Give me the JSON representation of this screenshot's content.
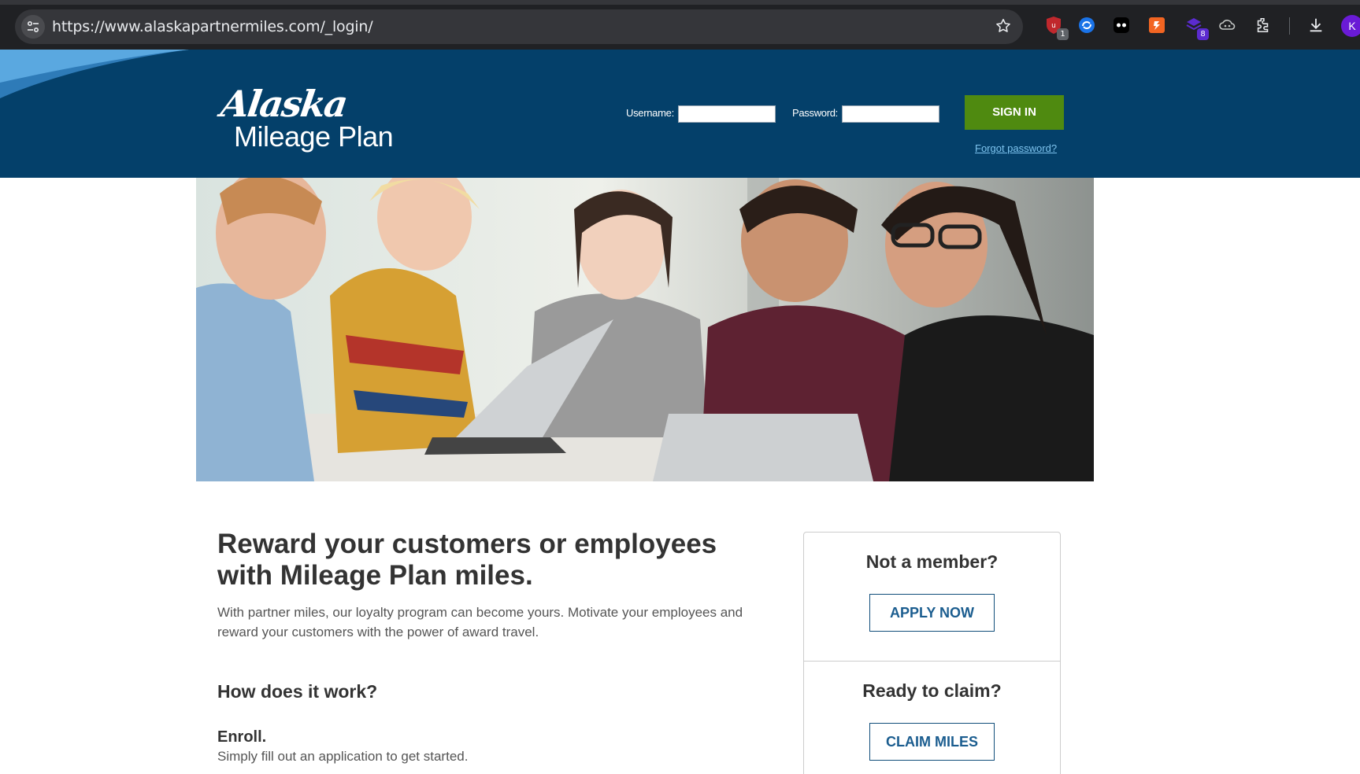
{
  "browser": {
    "url": "https://www.alaskapartnermiles.com/_login/",
    "extensions": [
      {
        "name": "ublock",
        "badge": "1",
        "color": "#c0282d"
      },
      {
        "name": "sync",
        "badge": "",
        "color": "#1a73e8"
      },
      {
        "name": "dark-ext",
        "badge": "",
        "color": "#000000"
      },
      {
        "name": "orange-ext",
        "badge": "",
        "color": "#f26522"
      },
      {
        "name": "purple-ext",
        "badge": "8",
        "color": "#5b2bd0"
      }
    ],
    "profile_initial": "K"
  },
  "header": {
    "logo_brand": "Alaska",
    "logo_product": "Mileage Plan",
    "username_label": "Username:",
    "username_value": "",
    "password_label": "Password:",
    "password_value": "",
    "signin_label": "SIGN IN",
    "forgot_label": "Forgot password?",
    "colors": {
      "header_bg": "#04406a",
      "signin_bg": "#4f8a10",
      "link": "#7ec4ef"
    }
  },
  "hero": {
    "alt": "Group of smiling people looking at a laptop"
  },
  "main": {
    "headline": "Reward your customers or employees with Mileage Plan miles.",
    "intro": "With partner miles, our loyalty program can become yours. Motivate your employees and reward your customers with the power of award travel.",
    "how_title": "How does it work?",
    "steps": [
      {
        "title": "Enroll.",
        "desc": "Simply fill out an application to get started."
      }
    ]
  },
  "card": {
    "not_member_title": "Not a member?",
    "apply_label": "APPLY NOW",
    "claim_title": "Ready to claim?",
    "claim_label": "CLAIM MILES"
  }
}
